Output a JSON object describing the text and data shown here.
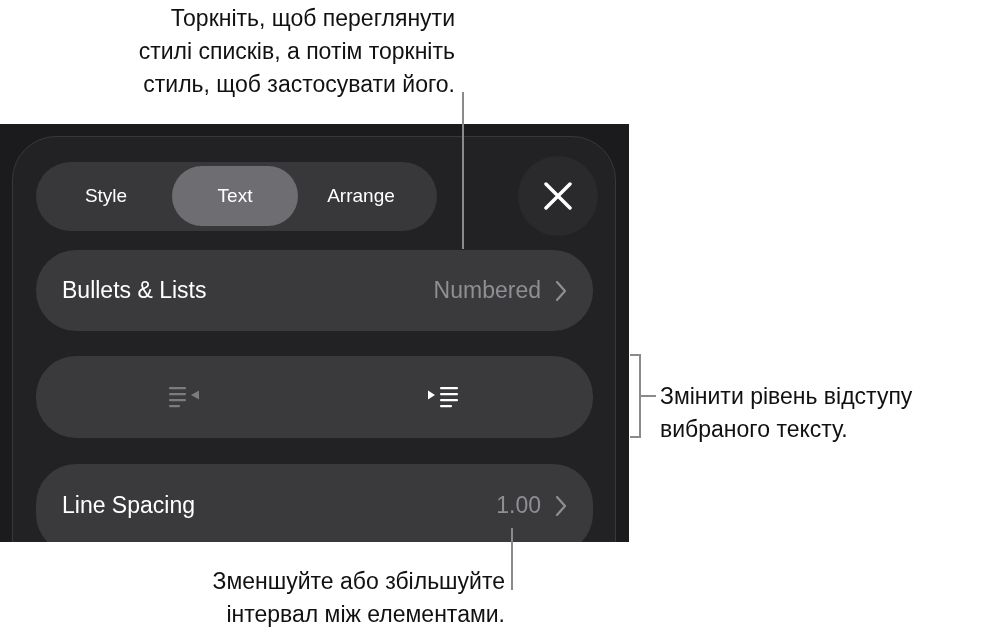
{
  "callouts": [
    {
      "kind": "top",
      "text": "Торкніть, щоб переглянути\nстилі списків, а потім торкніть\nстиль, щоб застосувати його."
    },
    {
      "kind": "right",
      "text": "Змінити рівень відступу\nвибраного тексту."
    },
    {
      "kind": "bottom",
      "text": "Зменшуйте або збільшуйте\nінтервал між елементами."
    }
  ],
  "tabs": [
    {
      "label": "Style",
      "selected": false
    },
    {
      "label": "Text",
      "selected": true
    },
    {
      "label": "Arrange",
      "selected": false
    }
  ],
  "rows": [
    {
      "label": "Bullets & Lists",
      "value": "Numbered"
    }
  ],
  "indent_buttons": [
    {
      "kind": "decrease",
      "disabled": true
    },
    {
      "kind": "increase",
      "disabled": false
    }
  ],
  "line_spacing": {
    "label": "Line Spacing",
    "value": "1.00"
  }
}
